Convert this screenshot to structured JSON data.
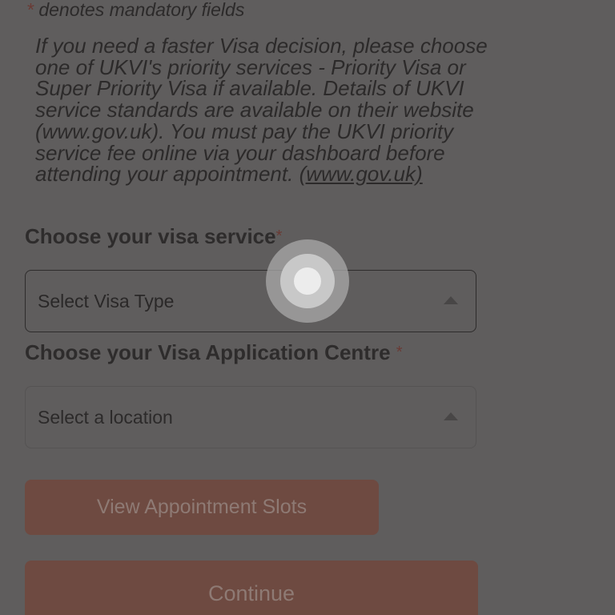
{
  "form": {
    "mandatory_star": "*",
    "mandatory_note": " denotes mandatory fields",
    "info_text": "If you need a faster Visa decision, please choose one of UKVI's priority services - Priority Visa or Super Priority Visa if available. Details of UKVI service standards are available on their website (www.gov.uk). You must pay the UKVI priority service fee online via your dashboard before attending your appointment. ",
    "info_link": "(www.gov.uk)",
    "visa_service": {
      "label": "Choose your visa service",
      "required_mark": "*",
      "selected": "Select Visa Type"
    },
    "visa_centre": {
      "label": "Choose your Visa Application Centre ",
      "required_mark": "*",
      "selected": "Select a location"
    },
    "view_slots_label": "View Appointment Slots",
    "continue_label": "Continue"
  },
  "icons": {
    "caret": "caret-up-icon",
    "touch": "touch-indicator-icon"
  }
}
